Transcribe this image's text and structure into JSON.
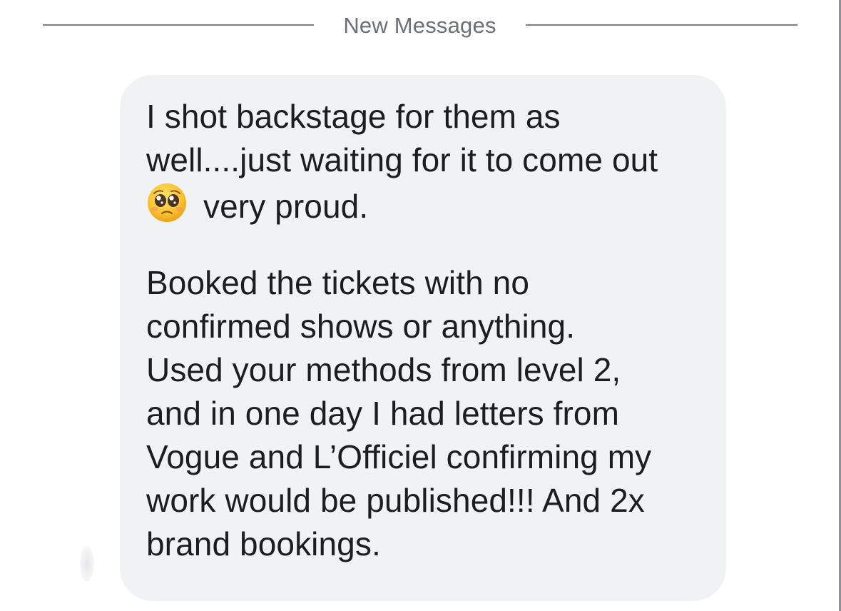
{
  "divider": {
    "label": "New Messages"
  },
  "message": {
    "lines": [
      "I shot backstage for them as",
      "well....just waiting for it to come out",
      "very proud."
    ],
    "emoji_name": "pleading-face-icon",
    "paragraph2": [
      "Booked the tickets with no",
      "confirmed shows or anything."
    ],
    "paragraph3": [
      "Used your methods from level 2,",
      "and in one day I had letters from",
      "Vogue and L’Officiel confirming my",
      "work would be published!!! And 2x",
      "brand bookings."
    ]
  },
  "colors": {
    "bubble_background": "#f1f2f4",
    "text": "#1b1d21",
    "divider": "#7b8087"
  }
}
